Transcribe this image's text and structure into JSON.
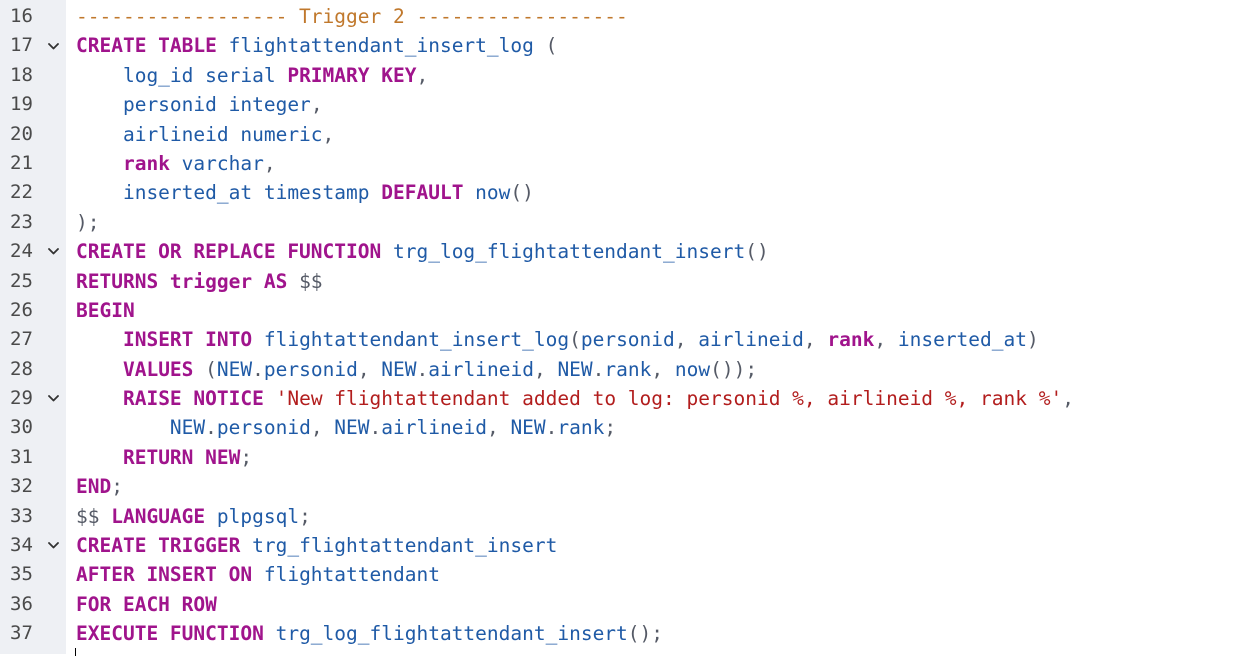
{
  "editor": {
    "lines": [
      {
        "number": "16",
        "fold": false,
        "tokens": [
          {
            "t": "------------------ Trigger 2 ------------------",
            "c": "cmt"
          }
        ]
      },
      {
        "number": "17",
        "fold": true,
        "tokens": [
          {
            "t": "CREATE TABLE",
            "c": "kw"
          },
          {
            "t": " flightattendant_insert_log ",
            "c": "id"
          },
          {
            "t": "(",
            "c": "pn"
          }
        ]
      },
      {
        "number": "18",
        "fold": false,
        "tokens": [
          {
            "t": "    log_id serial ",
            "c": "id"
          },
          {
            "t": "PRIMARY KEY",
            "c": "kw"
          },
          {
            "t": ",",
            "c": "pn"
          }
        ]
      },
      {
        "number": "19",
        "fold": false,
        "tokens": [
          {
            "t": "    personid integer",
            "c": "id"
          },
          {
            "t": ",",
            "c": "pn"
          }
        ]
      },
      {
        "number": "20",
        "fold": false,
        "tokens": [
          {
            "t": "    airlineid numeric",
            "c": "id"
          },
          {
            "t": ",",
            "c": "pn"
          }
        ]
      },
      {
        "number": "21",
        "fold": false,
        "tokens": [
          {
            "t": "    ",
            "c": "id"
          },
          {
            "t": "rank",
            "c": "kw"
          },
          {
            "t": " varchar",
            "c": "id"
          },
          {
            "t": ",",
            "c": "pn"
          }
        ]
      },
      {
        "number": "22",
        "fold": false,
        "tokens": [
          {
            "t": "    inserted_at timestamp ",
            "c": "id"
          },
          {
            "t": "DEFAULT",
            "c": "kw"
          },
          {
            "t": " now",
            "c": "id"
          },
          {
            "t": "()",
            "c": "pn"
          }
        ]
      },
      {
        "number": "23",
        "fold": false,
        "tokens": [
          {
            "t": ");",
            "c": "pn"
          }
        ]
      },
      {
        "number": "24",
        "fold": true,
        "tokens": [
          {
            "t": "CREATE OR REPLACE FUNCTION",
            "c": "kw"
          },
          {
            "t": " trg_log_flightattendant_insert",
            "c": "id"
          },
          {
            "t": "()",
            "c": "pn"
          }
        ]
      },
      {
        "number": "25",
        "fold": false,
        "tokens": [
          {
            "t": "RETURNS trigger AS",
            "c": "kw"
          },
          {
            "t": " $$",
            "c": "pn"
          }
        ]
      },
      {
        "number": "26",
        "fold": false,
        "tokens": [
          {
            "t": "BEGIN",
            "c": "kw"
          }
        ]
      },
      {
        "number": "27",
        "fold": false,
        "tokens": [
          {
            "t": "    ",
            "c": "id"
          },
          {
            "t": "INSERT INTO",
            "c": "kw"
          },
          {
            "t": " flightattendant_insert_log",
            "c": "id"
          },
          {
            "t": "(",
            "c": "pn"
          },
          {
            "t": "personid",
            "c": "id"
          },
          {
            "t": ", ",
            "c": "pn"
          },
          {
            "t": "airlineid",
            "c": "id"
          },
          {
            "t": ", ",
            "c": "pn"
          },
          {
            "t": "rank",
            "c": "kw"
          },
          {
            "t": ", ",
            "c": "pn"
          },
          {
            "t": "inserted_at",
            "c": "id"
          },
          {
            "t": ")",
            "c": "pn"
          }
        ]
      },
      {
        "number": "28",
        "fold": false,
        "tokens": [
          {
            "t": "    ",
            "c": "id"
          },
          {
            "t": "VALUES",
            "c": "kw"
          },
          {
            "t": " (",
            "c": "pn"
          },
          {
            "t": "NEW",
            "c": "id"
          },
          {
            "t": ".",
            "c": "pn"
          },
          {
            "t": "personid",
            "c": "id"
          },
          {
            "t": ", ",
            "c": "pn"
          },
          {
            "t": "NEW",
            "c": "id"
          },
          {
            "t": ".",
            "c": "pn"
          },
          {
            "t": "airlineid",
            "c": "id"
          },
          {
            "t": ", ",
            "c": "pn"
          },
          {
            "t": "NEW",
            "c": "id"
          },
          {
            "t": ".",
            "c": "pn"
          },
          {
            "t": "rank",
            "c": "id"
          },
          {
            "t": ", ",
            "c": "pn"
          },
          {
            "t": "now",
            "c": "id"
          },
          {
            "t": "());",
            "c": "pn"
          }
        ]
      },
      {
        "number": "29",
        "fold": true,
        "tokens": [
          {
            "t": "    ",
            "c": "id"
          },
          {
            "t": "RAISE NOTICE",
            "c": "kw"
          },
          {
            "t": " ",
            "c": "pn"
          },
          {
            "t": "'New flightattendant added to log: personid %, airlineid %, rank %'",
            "c": "str"
          },
          {
            "t": ",",
            "c": "pn"
          }
        ]
      },
      {
        "number": "30",
        "fold": false,
        "tokens": [
          {
            "t": "        NEW",
            "c": "id"
          },
          {
            "t": ".",
            "c": "pn"
          },
          {
            "t": "personid",
            "c": "id"
          },
          {
            "t": ", ",
            "c": "pn"
          },
          {
            "t": "NEW",
            "c": "id"
          },
          {
            "t": ".",
            "c": "pn"
          },
          {
            "t": "airlineid",
            "c": "id"
          },
          {
            "t": ", ",
            "c": "pn"
          },
          {
            "t": "NEW",
            "c": "id"
          },
          {
            "t": ".",
            "c": "pn"
          },
          {
            "t": "rank",
            "c": "id"
          },
          {
            "t": ";",
            "c": "pn"
          }
        ]
      },
      {
        "number": "31",
        "fold": false,
        "tokens": [
          {
            "t": "    ",
            "c": "id"
          },
          {
            "t": "RETURN NEW",
            "c": "kw"
          },
          {
            "t": ";",
            "c": "pn"
          }
        ]
      },
      {
        "number": "32",
        "fold": false,
        "tokens": [
          {
            "t": "END",
            "c": "kw"
          },
          {
            "t": ";",
            "c": "pn"
          }
        ]
      },
      {
        "number": "33",
        "fold": false,
        "tokens": [
          {
            "t": "$$ ",
            "c": "pn"
          },
          {
            "t": "LANGUAGE",
            "c": "kw"
          },
          {
            "t": " plpgsql",
            "c": "id"
          },
          {
            "t": ";",
            "c": "pn"
          }
        ]
      },
      {
        "number": "34",
        "fold": true,
        "tokens": [
          {
            "t": "CREATE TRIGGER",
            "c": "kw"
          },
          {
            "t": " trg_flightattendant_insert",
            "c": "id"
          }
        ]
      },
      {
        "number": "35",
        "fold": false,
        "tokens": [
          {
            "t": "AFTER INSERT ON",
            "c": "kw"
          },
          {
            "t": " flightattendant",
            "c": "id"
          }
        ]
      },
      {
        "number": "36",
        "fold": false,
        "tokens": [
          {
            "t": "FOR EACH ROW",
            "c": "kw"
          }
        ]
      },
      {
        "number": "37",
        "fold": false,
        "tokens": [
          {
            "t": "EXECUTE FUNCTION",
            "c": "kw"
          },
          {
            "t": " trg_log_flightattendant_insert",
            "c": "id"
          },
          {
            "t": "();",
            "c": "pn"
          }
        ]
      }
    ],
    "colors": {
      "keyword": "#a0148c",
      "identifier": "#1f5aa6",
      "string": "#b21d1d",
      "comment": "#c0782c",
      "punctuation": "#555a66",
      "gutter_bg": "#eef0f4",
      "line_number": "#4a4a4a"
    },
    "icons": {
      "fold": "chevron-down-icon"
    }
  }
}
